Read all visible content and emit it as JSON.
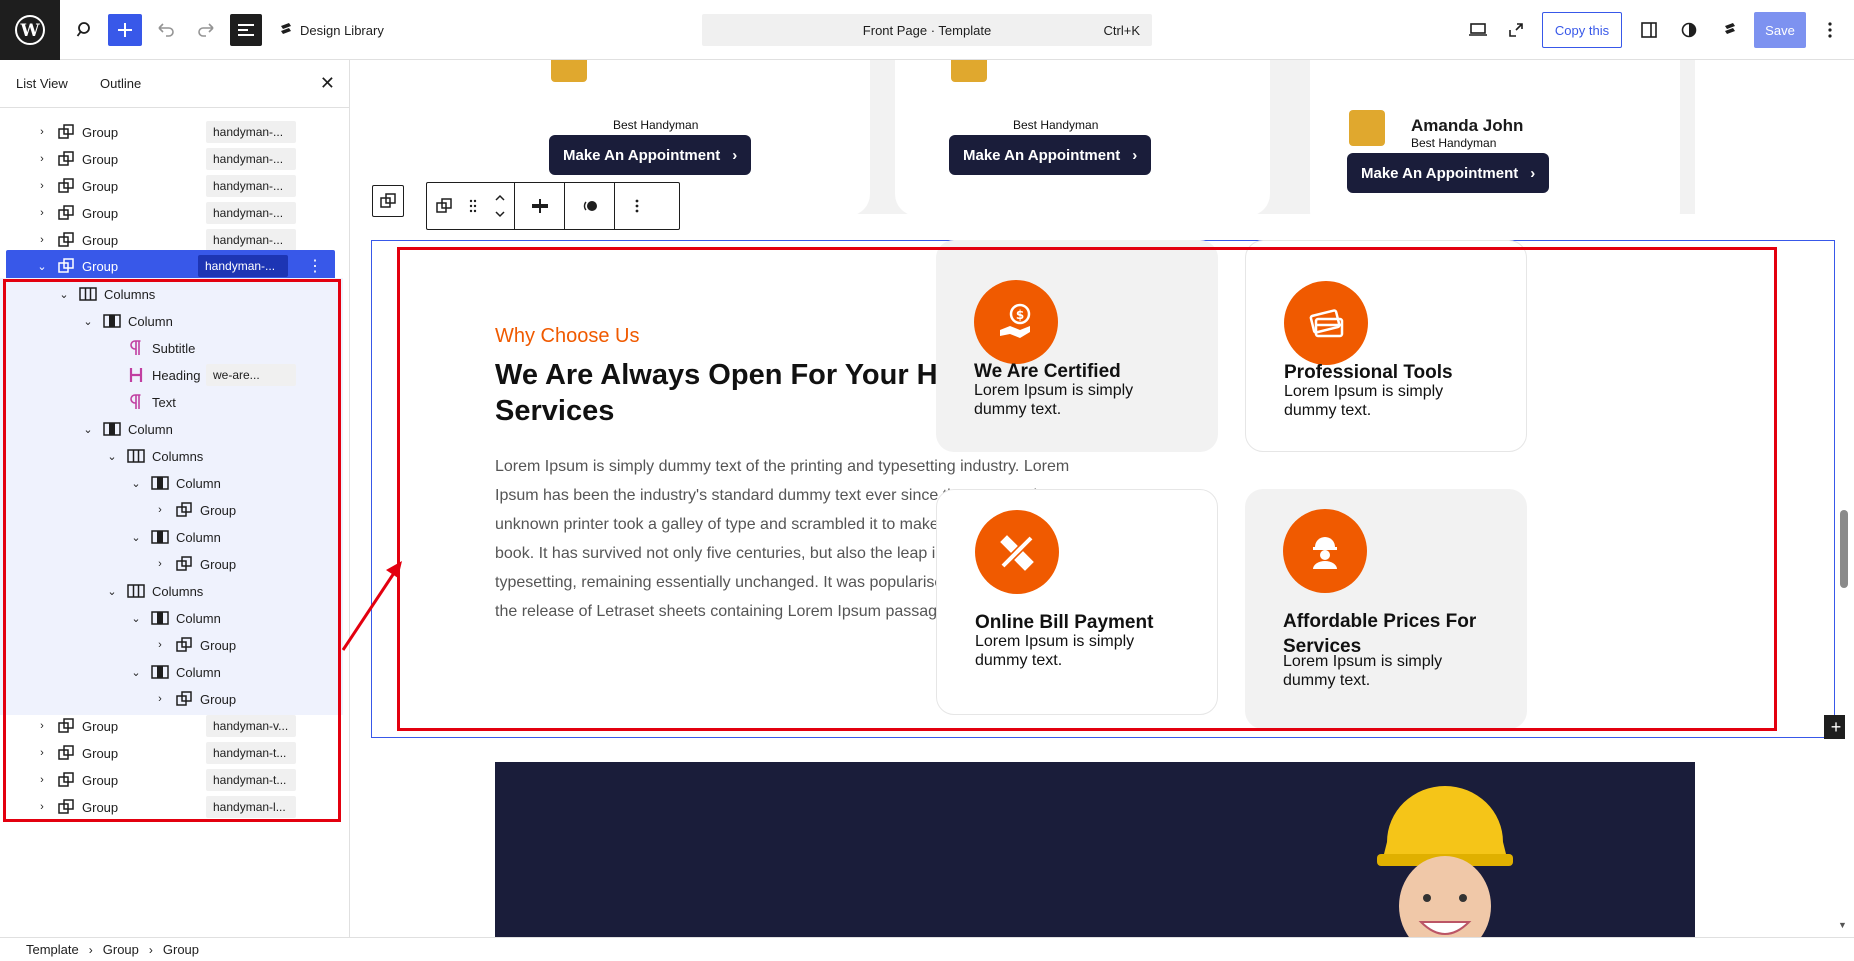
{
  "topbar": {
    "design_library": "Design Library",
    "command": "Front Page · Template",
    "shortcut": "Ctrl+K",
    "copy_label": "Copy this",
    "save_label": "Save"
  },
  "sidebar": {
    "tab_list": "List View",
    "tab_outline": "Outline",
    "rows": [
      {
        "label": "Group",
        "tag": "handyman-..."
      },
      {
        "label": "Group",
        "tag": "handyman-..."
      },
      {
        "label": "Group",
        "tag": "handyman-..."
      },
      {
        "label": "Group",
        "tag": "handyman-..."
      },
      {
        "label": "Group",
        "tag": "handyman-..."
      },
      {
        "label": "Group",
        "tag": "handyman-..."
      },
      {
        "label": "Columns"
      },
      {
        "label": "Column"
      },
      {
        "label": "Subtitle"
      },
      {
        "label": "Heading",
        "tag": "we-are..."
      },
      {
        "label": "Text"
      },
      {
        "label": "Column"
      },
      {
        "label": "Columns"
      },
      {
        "label": "Column"
      },
      {
        "label": "Group"
      },
      {
        "label": "Column"
      },
      {
        "label": "Group"
      },
      {
        "label": "Columns"
      },
      {
        "label": "Column"
      },
      {
        "label": "Group"
      },
      {
        "label": "Column"
      },
      {
        "label": "Group"
      },
      {
        "label": "Group",
        "tag": "handyman-v..."
      },
      {
        "label": "Group",
        "tag": "handyman-t..."
      },
      {
        "label": "Group",
        "tag": "handyman-t..."
      },
      {
        "label": "Group",
        "tag": "handyman-l..."
      }
    ]
  },
  "breadcrumb": [
    "Template",
    "Group",
    "Group"
  ],
  "top_cards": {
    "best": "Best Handyman",
    "name": "Amanda John",
    "button": "Make An Appointment"
  },
  "section": {
    "subtitle": "Why Choose Us",
    "heading": "We Are Always Open For Your Handyman Services",
    "body": "Lorem Ipsum is simply dummy text of the printing and typesetting industry. Lorem Ipsum has been the industry's standard dummy text ever since the 1500s, when an unknown printer took a galley of type and scrambled it to make a type specimen book. It has survived not only five centuries, but also the leap into electronic typesetting, remaining essentially unchanged. It was popularised in the 1960s with the release of Letraset sheets containing Lorem Ipsum passages,"
  },
  "features": [
    {
      "title": "We Are Certified",
      "desc": "Lorem Ipsum is simply dummy text.",
      "icon": "certified-money-icon"
    },
    {
      "title": "Professional Tools",
      "desc": "Lorem Ipsum is simply dummy text.",
      "icon": "credit-card-icon"
    },
    {
      "title": "Online Bill Payment",
      "desc": "Lorem Ipsum is simply dummy text.",
      "icon": "tools-icon"
    },
    {
      "title": "Affordable Prices For Services",
      "desc": "Lorem Ipsum is simply dummy text.",
      "icon": "worker-icon"
    }
  ],
  "colors": {
    "accent": "#f05a00",
    "wp_blue": "#3858e9",
    "navy": "#1a1d3a",
    "highlight_red": "#e3000f"
  }
}
